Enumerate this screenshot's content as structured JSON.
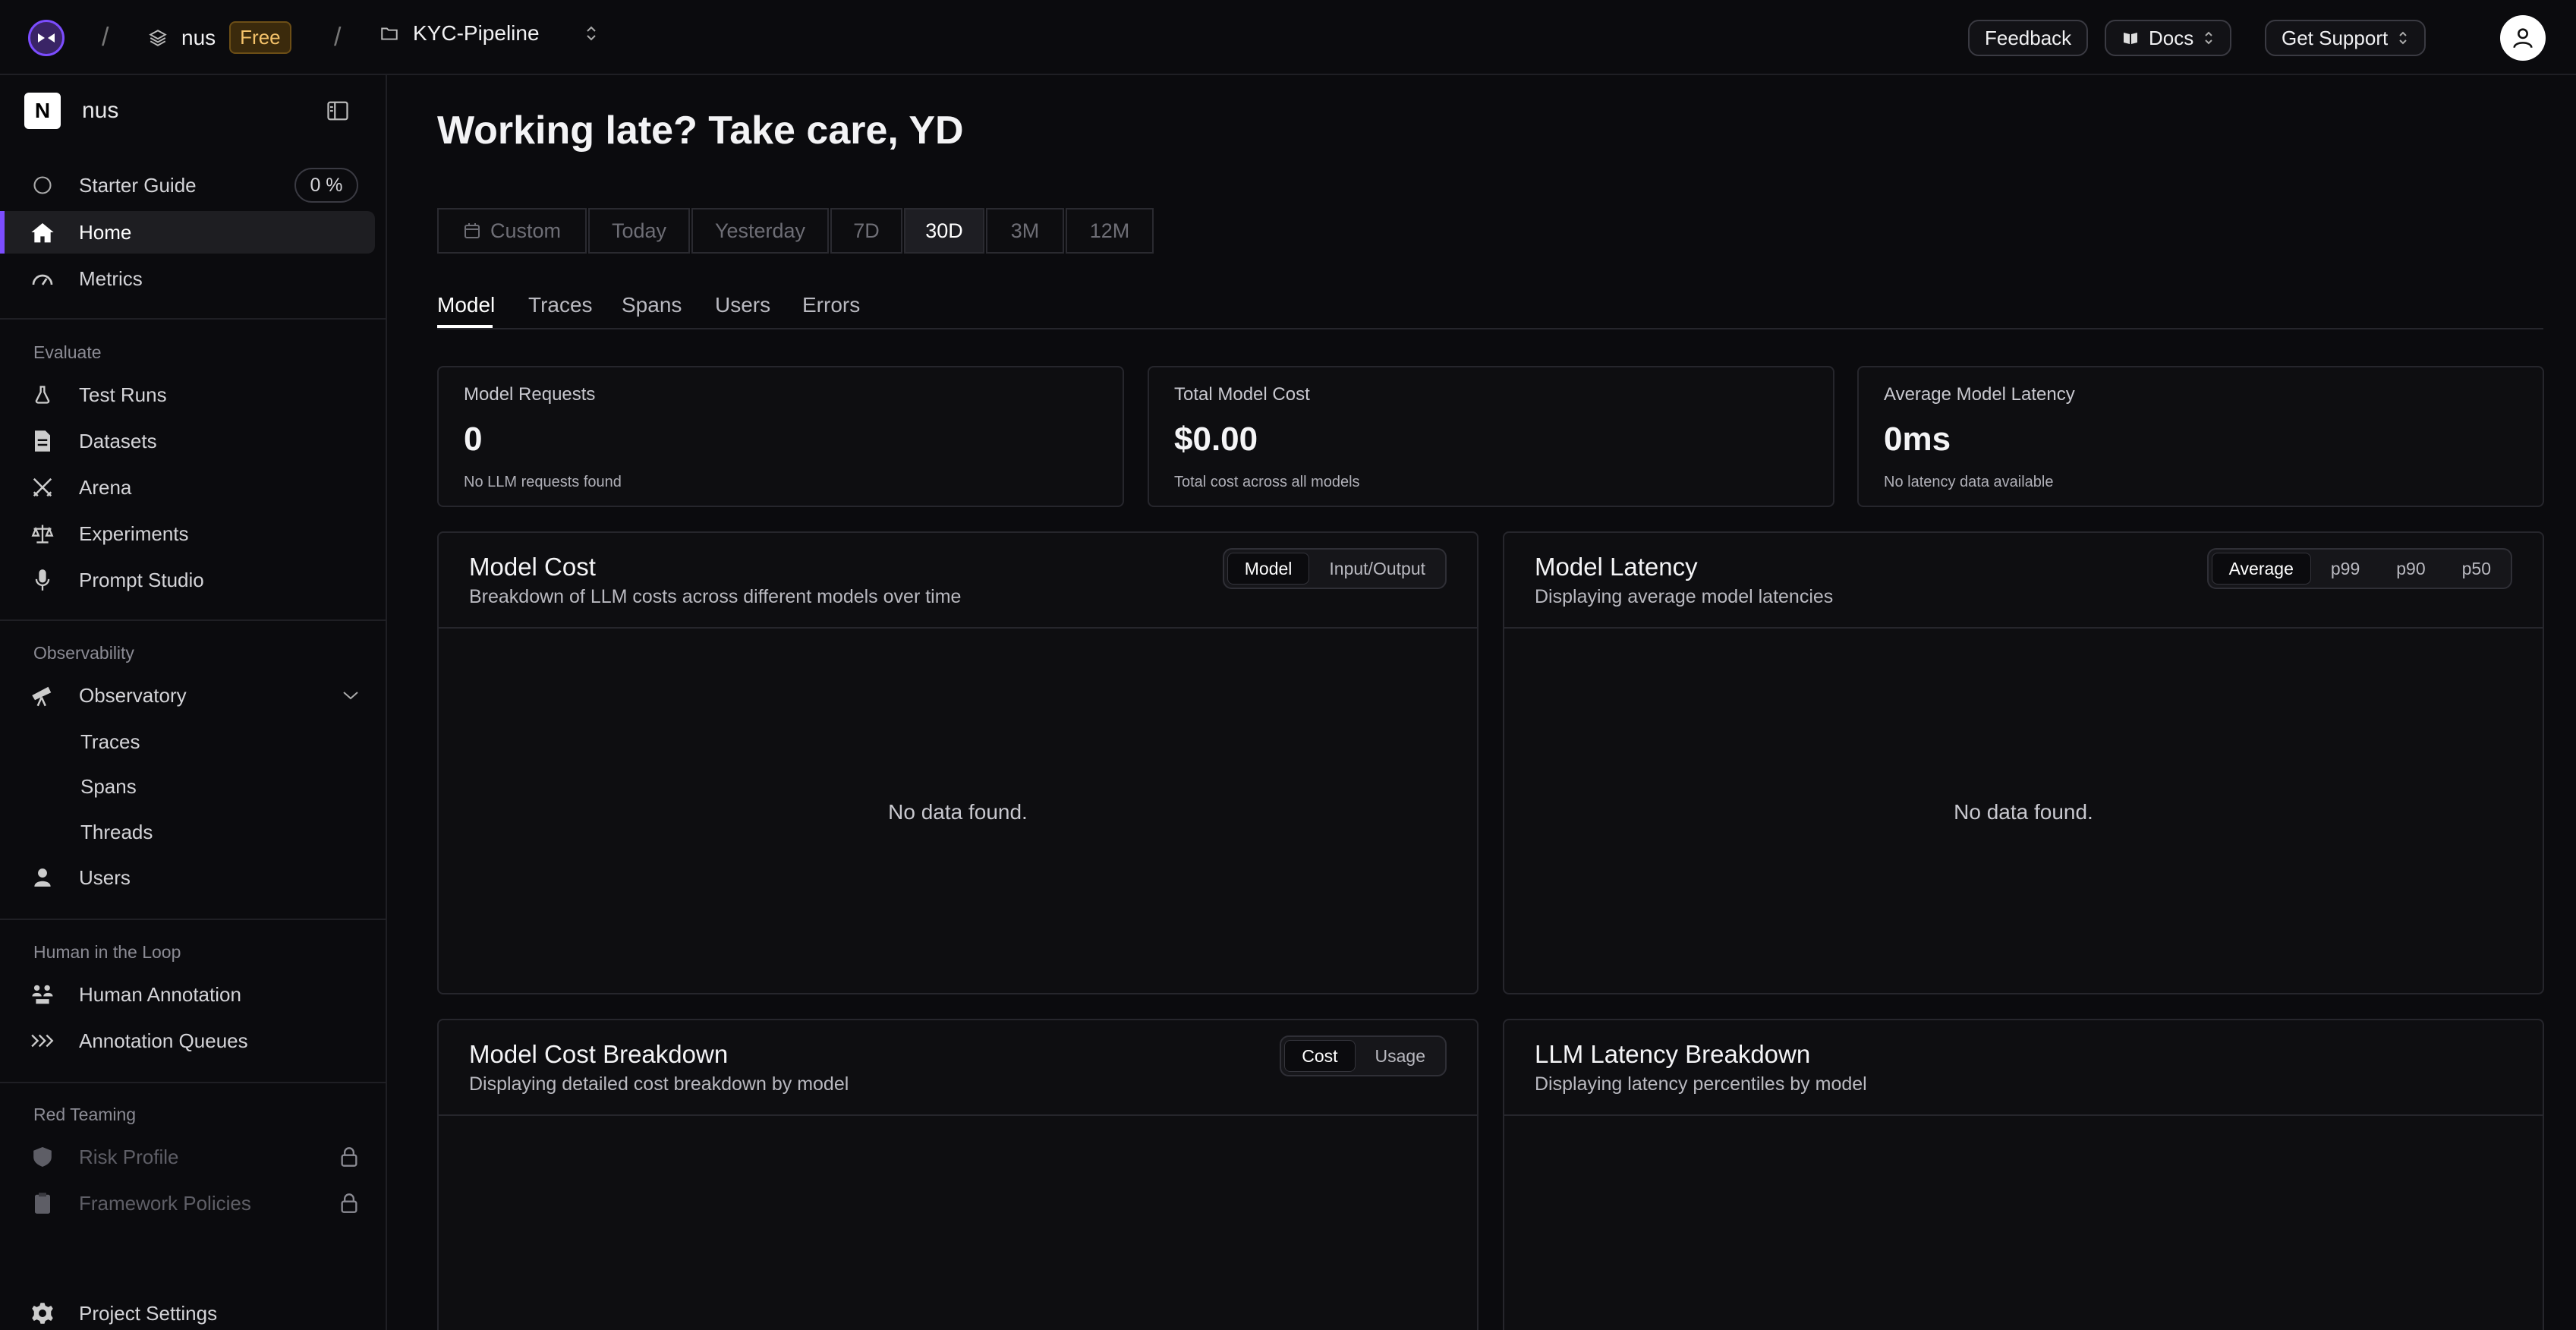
{
  "topbar": {
    "workspace": "nus",
    "plan_badge": "Free",
    "project": "KYC-Pipeline",
    "feedback": "Feedback",
    "docs": "Docs",
    "support": "Get Support",
    "separator": "/"
  },
  "sidebar": {
    "workspace_initial": "N",
    "workspace_name": "nus",
    "starter_guide": "Starter Guide",
    "starter_pct": "0 %",
    "home": "Home",
    "metrics": "Metrics",
    "evaluate_label": "Evaluate",
    "test_runs": "Test Runs",
    "datasets": "Datasets",
    "arena": "Arena",
    "experiments": "Experiments",
    "prompt_studio": "Prompt Studio",
    "observability_label": "Observability",
    "observatory": "Observatory",
    "traces": "Traces",
    "spans": "Spans",
    "threads": "Threads",
    "users": "Users",
    "hitl_label": "Human in the Loop",
    "human_annotation": "Human Annotation",
    "annotation_queues": "Annotation Queues",
    "red_team_label": "Red Teaming",
    "risk_profile": "Risk Profile",
    "framework_policies": "Framework Policies",
    "project_settings": "Project Settings"
  },
  "main": {
    "greeting": "Working late? Take care, YD",
    "ranges": [
      "Custom",
      "Today",
      "Yesterday",
      "7D",
      "30D",
      "3M",
      "12M"
    ],
    "active_range": "30D",
    "tabs": [
      "Model",
      "Traces",
      "Spans",
      "Users",
      "Errors"
    ],
    "active_tab": "Model",
    "stats": [
      {
        "label": "Model Requests",
        "value": "0",
        "note": "No LLM requests found"
      },
      {
        "label": "Total Model Cost",
        "value": "$0.00",
        "note": "Total cost across all models"
      },
      {
        "label": "Average Model Latency",
        "value": "0ms",
        "note": "No latency data available"
      }
    ],
    "model_cost": {
      "title": "Model Cost",
      "subtitle": "Breakdown of LLM costs across different models over time",
      "toggle": [
        "Model",
        "Input/Output"
      ],
      "empty": "No data found."
    },
    "model_latency": {
      "title": "Model Latency",
      "subtitle": "Displaying average model latencies",
      "toggle": [
        "Average",
        "p99",
        "p90",
        "p50"
      ],
      "empty": "No data found."
    },
    "cost_breakdown": {
      "title": "Model Cost Breakdown",
      "subtitle": "Displaying detailed cost breakdown by model",
      "toggle": [
        "Cost",
        "Usage"
      ]
    },
    "latency_breakdown": {
      "title": "LLM Latency Breakdown",
      "subtitle": "Displaying latency percentiles by model"
    }
  },
  "colors": {
    "accent": "#7c4dff",
    "background": "#0b0b0e",
    "badge": "#f4c26a"
  }
}
